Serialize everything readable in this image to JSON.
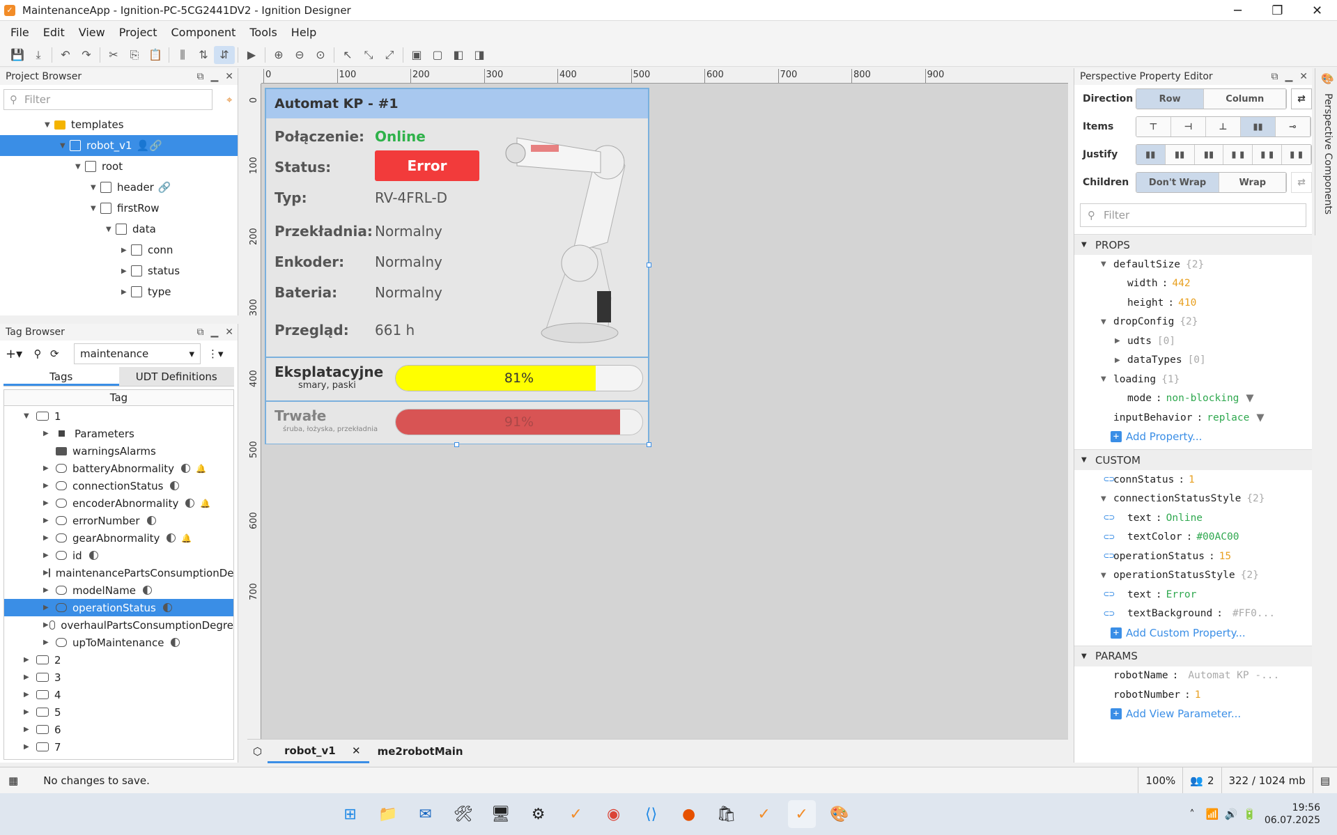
{
  "window": {
    "title": "MaintenanceApp - Ignition-PC-5CG2441DV2 - Ignition Designer"
  },
  "menu": [
    "File",
    "Edit",
    "View",
    "Project",
    "Component",
    "Tools",
    "Help"
  ],
  "project_browser": {
    "title": "Project Browser",
    "filter_placeholder": "Filter",
    "items": [
      {
        "label": "templates",
        "depth": 3,
        "kind": "folder"
      },
      {
        "label": "robot_v1",
        "depth": 4,
        "kind": "view",
        "selected": true
      },
      {
        "label": "root",
        "depth": 5,
        "kind": "container"
      },
      {
        "label": "header",
        "depth": 6,
        "kind": "container"
      },
      {
        "label": "firstRow",
        "depth": 6,
        "kind": "container"
      },
      {
        "label": "data",
        "depth": 7,
        "kind": "container"
      },
      {
        "label": "conn",
        "depth": 8,
        "kind": "container"
      },
      {
        "label": "status",
        "depth": 8,
        "kind": "container"
      },
      {
        "label": "type",
        "depth": 8,
        "kind": "container"
      }
    ]
  },
  "tag_browser": {
    "title": "Tag Browser",
    "provider": "maintenance",
    "tabs": [
      "Tags",
      "UDT Definitions"
    ],
    "column": "Tag",
    "root": "1",
    "children": [
      {
        "label": "Parameters",
        "icon": "square"
      },
      {
        "label": "warningsAlarms",
        "icon": "folder"
      },
      {
        "label": "batteryAbnormality",
        "icon": "udt",
        "alarm": true
      },
      {
        "label": "connectionStatus",
        "icon": "udt",
        "alarm": false
      },
      {
        "label": "encoderAbnormality",
        "icon": "udt",
        "alarm": true
      },
      {
        "label": "errorNumber",
        "icon": "udt",
        "alarm": false
      },
      {
        "label": "gearAbnormality",
        "icon": "udt",
        "alarm": true
      },
      {
        "label": "id",
        "icon": "udt",
        "alarm": false
      },
      {
        "label": "maintenancePartsConsumptionDe",
        "icon": "udt",
        "alarm": false,
        "noop": true
      },
      {
        "label": "modelName",
        "icon": "udt",
        "alarm": false
      },
      {
        "label": "operationStatus",
        "icon": "udt",
        "alarm": false,
        "selected": true
      },
      {
        "label": "overhaulPartsConsumptionDegre",
        "icon": "udt",
        "alarm": false,
        "noop": true
      },
      {
        "label": "upToMaintenance",
        "icon": "udt",
        "alarm": false
      }
    ],
    "others": [
      "2",
      "3",
      "4",
      "5",
      "6",
      "7"
    ]
  },
  "ruler": {
    "top": [
      "0",
      "100",
      "200",
      "300",
      "400",
      "500",
      "600",
      "700",
      "800",
      "900"
    ],
    "left": [
      "0",
      "100",
      "200",
      "300",
      "400",
      "500",
      "600",
      "700"
    ]
  },
  "view": {
    "header": "Automat KP - #1",
    "rows": [
      {
        "label": "Połączenie:",
        "value": "Online",
        "style": "online"
      },
      {
        "label": "Status:",
        "value": "Error",
        "style": "error"
      },
      {
        "label": "Typ:",
        "value": "RV-4FRL-D",
        "style": "plain"
      },
      {
        "label": "Przekładnia:",
        "value": "Normalny",
        "style": "plain"
      },
      {
        "label": "Enkoder:",
        "value": "Normalny",
        "style": "plain"
      },
      {
        "label": "Bateria:",
        "value": "Normalny",
        "style": "plain"
      },
      {
        "label": "Przegląd:",
        "value": "661 h",
        "style": "plain"
      }
    ],
    "bars": [
      {
        "title": "Eksplatacyjne",
        "subtitle": "smary, paski",
        "percent_label": "81%",
        "value": 0.81,
        "color": "#ffff00",
        "faded": false
      },
      {
        "title": "Trwałe",
        "subtitle": "śruba, łożyska, przekładnia",
        "percent_label": "91%",
        "value": 0.91,
        "color": "#d63b3b",
        "faded": true
      }
    ],
    "colors": {
      "online": "#2fb24a",
      "error": "#f23b3b"
    }
  },
  "editor_tabs": [
    "robot_v1",
    "me2robotMain"
  ],
  "property_editor": {
    "title": "Perspective Property Editor",
    "direction": {
      "label": "Direction",
      "options": [
        "Row",
        "Column"
      ],
      "active": "Row"
    },
    "items_label": "Items",
    "justify_label": "Justify",
    "children": {
      "label": "Children",
      "options": [
        "Don't Wrap",
        "Wrap"
      ],
      "active": "Don't Wrap"
    },
    "filter_placeholder": "Filter",
    "props_title": "PROPS",
    "props": [
      {
        "depth": 0,
        "key": "defaultSize",
        "count": "{2}",
        "open": true
      },
      {
        "depth": 1,
        "key": "width",
        "val": "442",
        "type": "n"
      },
      {
        "depth": 1,
        "key": "height",
        "val": "410",
        "type": "n"
      },
      {
        "depth": 0,
        "key": "dropConfig",
        "count": "{2}",
        "open": true
      },
      {
        "depth": 1,
        "key": "udts",
        "count": "[0]",
        "closed": true
      },
      {
        "depth": 1,
        "key": "dataTypes",
        "count": "[0]",
        "closed": true
      },
      {
        "depth": 0,
        "key": "loading",
        "count": "{1}",
        "open": true
      },
      {
        "depth": 1,
        "key": "mode",
        "val": "non-blocking",
        "type": "s",
        "dropdown": true
      },
      {
        "depth": 0,
        "key": "inputBehavior",
        "val": "replace",
        "type": "s",
        "dropdown": true
      }
    ],
    "add_property": "Add Property...",
    "custom_title": "CUSTOM",
    "custom": [
      {
        "depth": 0,
        "key": "connStatus",
        "val": "1",
        "type": "n",
        "link": true
      },
      {
        "depth": 0,
        "key": "connectionStatusStyle",
        "count": "{2}",
        "open": true
      },
      {
        "depth": 1,
        "key": "text",
        "val": "Online",
        "type": "s",
        "link": true
      },
      {
        "depth": 1,
        "key": "textColor",
        "val": "#00AC00",
        "type": "s",
        "link": true
      },
      {
        "depth": 0,
        "key": "operationStatus",
        "val": "15",
        "type": "n",
        "link": true
      },
      {
        "depth": 0,
        "key": "operationStatusStyle",
        "count": "{2}",
        "open": true
      },
      {
        "depth": 1,
        "key": "text",
        "val": "Error",
        "type": "s",
        "link": true
      },
      {
        "depth": 1,
        "key": "textBackground",
        "val": "#FF0...",
        "type": "g",
        "link": true
      }
    ],
    "add_custom": "Add Custom Property...",
    "params_title": "PARAMS",
    "params": [
      {
        "depth": 0,
        "key": "robotName",
        "val": "Automat KP -...",
        "type": "g"
      },
      {
        "depth": 0,
        "key": "robotNumber",
        "val": "1",
        "type": "n"
      }
    ],
    "add_param": "Add View Parameter...",
    "side_tab": "Perspective Components"
  },
  "status": {
    "message": "No changes to save.",
    "zoom": "100%",
    "users": "2",
    "memory": "322 / 1024 mb"
  },
  "taskbar": {
    "time": "19:56",
    "date": "06.07.2025"
  }
}
